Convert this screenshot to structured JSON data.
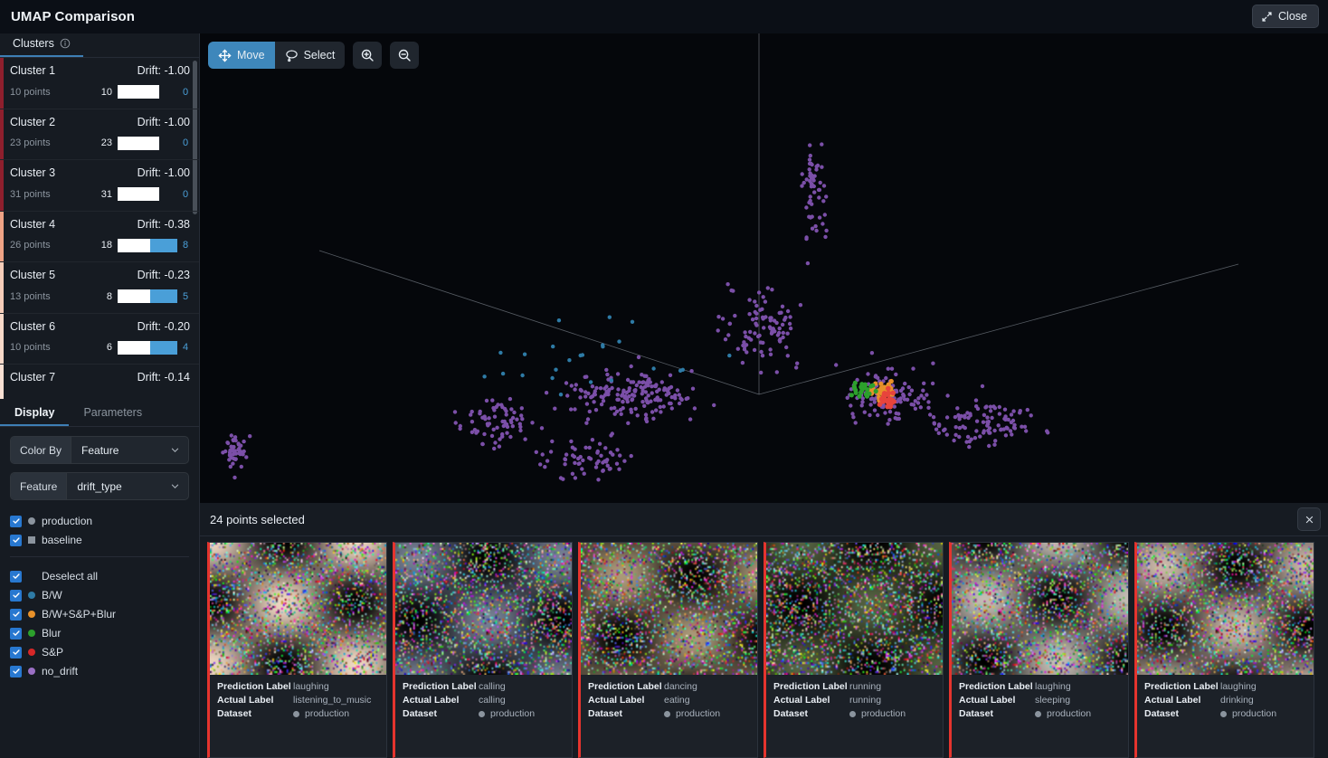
{
  "window": {
    "title": "UMAP Comparison",
    "close_label": "Close",
    "close_icon": "collapse-arrows-icon"
  },
  "sidebar": {
    "clusters_tab": {
      "label": "Clusters",
      "icon": "info-icon"
    },
    "clusters": [
      {
        "name": "Cluster 1",
        "drift": "Drift: -1.00",
        "points": "10 points",
        "left": "10",
        "right": "0",
        "left_w": 46,
        "right_w": 0,
        "stripe": "#8e1f2d"
      },
      {
        "name": "Cluster 2",
        "drift": "Drift: -1.00",
        "points": "23 points",
        "left": "23",
        "right": "0",
        "left_w": 46,
        "right_w": 0,
        "stripe": "#8e1f2d"
      },
      {
        "name": "Cluster 3",
        "drift": "Drift: -1.00",
        "points": "31 points",
        "left": "31",
        "right": "0",
        "left_w": 46,
        "right_w": 0,
        "stripe": "#8e1f2d"
      },
      {
        "name": "Cluster 4",
        "drift": "Drift: -0.38",
        "points": "26 points",
        "left": "18",
        "right": "8",
        "left_w": 36,
        "right_w": 30,
        "stripe": "#efa385"
      },
      {
        "name": "Cluster 5",
        "drift": "Drift: -0.23",
        "points": "13 points",
        "left": "8",
        "right": "5",
        "left_w": 36,
        "right_w": 30,
        "stripe": "#f5cdb9"
      },
      {
        "name": "Cluster 6",
        "drift": "Drift: -0.20",
        "points": "10 points",
        "left": "6",
        "right": "4",
        "left_w": 36,
        "right_w": 30,
        "stripe": "#f7d9c9"
      },
      {
        "name": "Cluster 7",
        "drift": "Drift: -0.14",
        "points": "",
        "left": "",
        "right": "",
        "left_w": 0,
        "right_w": 0,
        "stripe": "#f8e0d3"
      }
    ],
    "panel_tabs": [
      {
        "label": "Display",
        "active": true
      },
      {
        "label": "Parameters",
        "active": false
      }
    ],
    "controls": [
      {
        "label": "Color By",
        "value": "Feature",
        "icon": "chevron-down-icon"
      },
      {
        "label": "Feature",
        "value": "drift_type",
        "icon": "chevron-down-icon"
      }
    ],
    "dataset_legend": [
      {
        "label": "production",
        "color": "#8b949e",
        "shape": "circle",
        "checked": true
      },
      {
        "label": "baseline",
        "color": "#8b949e",
        "shape": "square",
        "checked": true
      }
    ],
    "feature_legend": [
      {
        "label": "Deselect all",
        "color": "",
        "shape": "none",
        "checked": true
      },
      {
        "label": "B/W",
        "color": "#2e7ba6",
        "shape": "circle",
        "checked": true
      },
      {
        "label": "B/W+S&P+Blur",
        "color": "#e8912a",
        "shape": "circle",
        "checked": true
      },
      {
        "label": "Blur",
        "color": "#2ca02c",
        "shape": "circle",
        "checked": true
      },
      {
        "label": "S&P",
        "color": "#d62728",
        "shape": "circle",
        "checked": true
      },
      {
        "label": "no_drift",
        "color": "#9a6fc4",
        "shape": "circle",
        "checked": true
      }
    ]
  },
  "plot": {
    "tools": [
      {
        "label": "Move",
        "icon": "move-icon",
        "active": true
      },
      {
        "label": "Select",
        "icon": "lasso-select-icon",
        "active": false
      }
    ],
    "zoom_buttons": [
      {
        "icon": "zoom-in-icon",
        "label": ""
      },
      {
        "icon": "zoom-out-icon",
        "label": ""
      }
    ],
    "background": "#05070b",
    "axis_color": "#9aa3ad"
  },
  "selection": {
    "title": "24 points selected",
    "close_icon": "close-icon",
    "field_labels": {
      "prediction": "Prediction Label",
      "actual": "Actual Label",
      "dataset": "Dataset"
    },
    "accent": "#e5342e",
    "cards": [
      {
        "prediction": "laughing",
        "actual": "listening_to_music",
        "dataset": "production",
        "seed": 11,
        "base": "#d9c3b0"
      },
      {
        "prediction": "calling",
        "actual": "calling",
        "dataset": "production",
        "seed": 29,
        "base": "#6b7486"
      },
      {
        "prediction": "dancing",
        "actual": "eating",
        "dataset": "production",
        "seed": 47,
        "base": "#9c8b6e"
      },
      {
        "prediction": "running",
        "actual": "running",
        "dataset": "production",
        "seed": 63,
        "base": "#4e5a3c"
      },
      {
        "prediction": "laughing",
        "actual": "sleeping",
        "dataset": "production",
        "seed": 85,
        "base": "#b2aca4"
      },
      {
        "prediction": "laughing",
        "actual": "drinking",
        "dataset": "production",
        "seed": 101,
        "base": "#b8a79a"
      }
    ]
  },
  "chart_data": {
    "type": "scatter",
    "title": "UMAP Comparison 3D projection",
    "projection": "3d",
    "origin": [
      848,
      437
    ],
    "axes": [
      {
        "name": "axis-left",
        "from": [
          848,
          437
        ],
        "to": [
          362,
          278
        ]
      },
      {
        "name": "axis-right",
        "from": [
          848,
          437
        ],
        "to": [
          1378,
          293
        ]
      },
      {
        "name": "axis-up",
        "from": [
          848,
          437
        ],
        "to": [
          848,
          38
        ]
      }
    ],
    "legend_position": "sidebar-left",
    "series": [
      {
        "name": "no_drift",
        "color": "#9a6fc4",
        "approx_count": 640
      },
      {
        "name": "B/W",
        "color": "#2e7ba6",
        "approx_count": 24
      },
      {
        "name": "B/W+S&P+Blur",
        "color": "#e8912a",
        "approx_count": 30
      },
      {
        "name": "Blur",
        "color": "#2ca02c",
        "approx_count": 22
      },
      {
        "name": "S&P",
        "color": "#d62728",
        "approx_count": 26
      }
    ]
  }
}
